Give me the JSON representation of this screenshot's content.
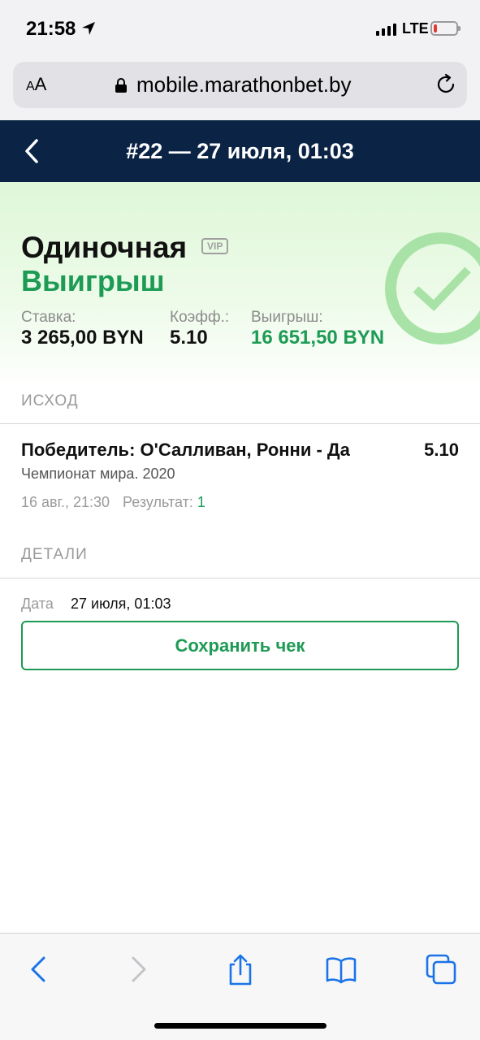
{
  "status_bar": {
    "time": "21:58",
    "network": "LTE"
  },
  "browser": {
    "text_size_label": "AA",
    "url": "mobile.marathonbet.by"
  },
  "header": {
    "title": "#22 — 27 июля, 01:03"
  },
  "summary": {
    "bet_type": "Одиночная",
    "badge": "VIP",
    "status": "Выигрыш",
    "stake_label": "Ставка:",
    "stake_value": "3 265,00 BYN",
    "odds_label": "Коэфф.:",
    "odds_value": "5.10",
    "win_label": "Выигрыш:",
    "win_value": "16 651,50 BYN"
  },
  "outcome": {
    "section_title": "ИСХОД",
    "selection": "Победитель: О'Салливан, Ронни - Да",
    "odds": "5.10",
    "event": "Чемпионат мира. 2020",
    "event_date": "16 авг., 21:30",
    "result_label": "Результат:",
    "result_value": "1"
  },
  "details": {
    "section_title": "ДЕТАЛИ",
    "date_label": "Дата",
    "date_value": "27 июля, 01:03",
    "save_button": "Сохранить чек"
  },
  "colors": {
    "header_bg": "#0b2446",
    "win_green": "#1d9b55",
    "check_green": "#a9e2a6",
    "ios_blue": "#1a73e8"
  }
}
